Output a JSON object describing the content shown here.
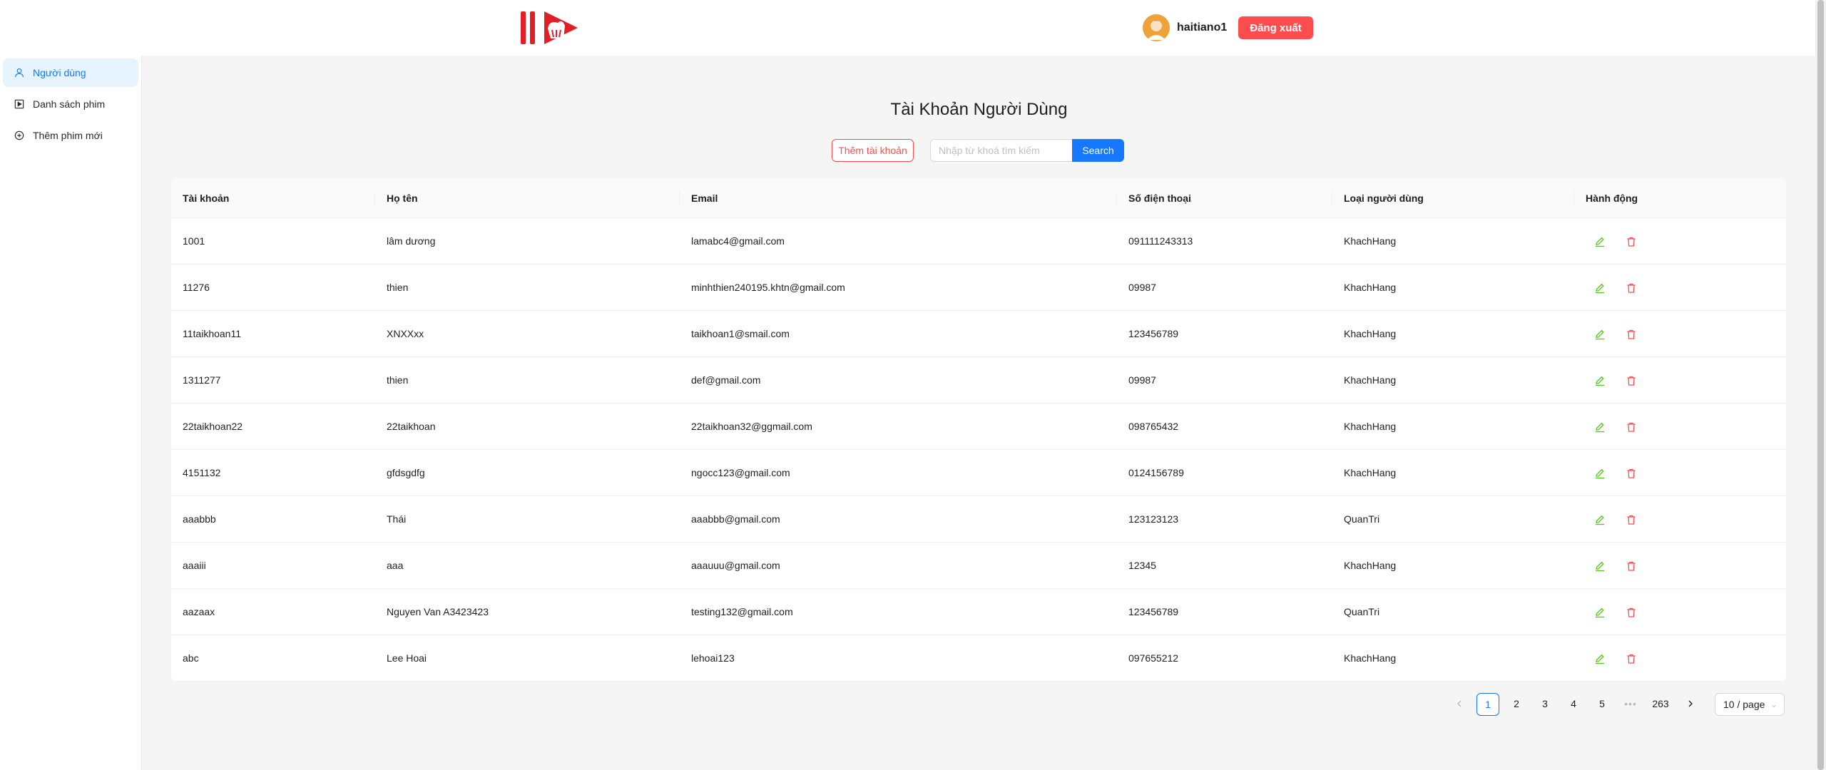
{
  "header": {
    "username": "haitiano1",
    "logout_label": "Đăng xuất"
  },
  "sidebar": {
    "items": [
      {
        "label": "Người dùng",
        "icon": "user-icon",
        "active": true
      },
      {
        "label": "Danh sách phim",
        "icon": "play-square-icon",
        "active": false
      },
      {
        "label": "Thêm phim mới",
        "icon": "plus-circle-icon",
        "active": false
      }
    ]
  },
  "main": {
    "title": "Tài Khoản Người Dùng",
    "add_label": "Thêm tài khoản",
    "search_placeholder": "Nhập từ khoá tìm kiếm",
    "search_label": "Search"
  },
  "table": {
    "columns": [
      "Tài khoản",
      "Họ tên",
      "Email",
      "Số điện thoại",
      "Loại người dùng",
      "Hành động"
    ],
    "rows": [
      {
        "account": "1001",
        "name": "lâm dương",
        "email": "lamabc4@gmail.com",
        "phone": "091111243313",
        "type": "KhachHang"
      },
      {
        "account": "11276",
        "name": "thien",
        "email": "minhthien240195.khtn@gmail.com",
        "phone": "09987",
        "type": "KhachHang"
      },
      {
        "account": "11taikhoan11",
        "name": "XNXXxx",
        "email": "taikhoan1@smail.com",
        "phone": "123456789",
        "type": "KhachHang"
      },
      {
        "account": "1311277",
        "name": "thien",
        "email": "def@gmail.com",
        "phone": "09987",
        "type": "KhachHang"
      },
      {
        "account": "22taikhoan22",
        "name": "22taikhoan",
        "email": "22taikhoan32@ggmail.com",
        "phone": "098765432",
        "type": "KhachHang"
      },
      {
        "account": "4151132",
        "name": "gfdsgdfg",
        "email": "ngocc123@gmail.com",
        "phone": "0124156789",
        "type": "KhachHang"
      },
      {
        "account": "aaabbb",
        "name": "Thái",
        "email": "aaabbb@gmail.com",
        "phone": "123123123",
        "type": "QuanTri"
      },
      {
        "account": "aaaiii",
        "name": "aaa",
        "email": "aaauuu@gmail.com",
        "phone": "12345",
        "type": "KhachHang"
      },
      {
        "account": "aazaax",
        "name": "Nguyen Van A3423423",
        "email": "testing132@gmail.com",
        "phone": "123456789",
        "type": "QuanTri"
      },
      {
        "account": "abc",
        "name": "Lee Hoai",
        "email": "lehoai123",
        "phone": "097655212",
        "type": "KhachHang"
      }
    ]
  },
  "pagination": {
    "pages": [
      "1",
      "2",
      "3",
      "4",
      "5"
    ],
    "current": "1",
    "ellipsis": "•••",
    "last": "263",
    "page_size_label": "10 / page"
  },
  "colors": {
    "primary": "#1677ff",
    "danger": "#ff4d4f",
    "edit": "#52c41a",
    "logo_red": "#e01f26"
  }
}
